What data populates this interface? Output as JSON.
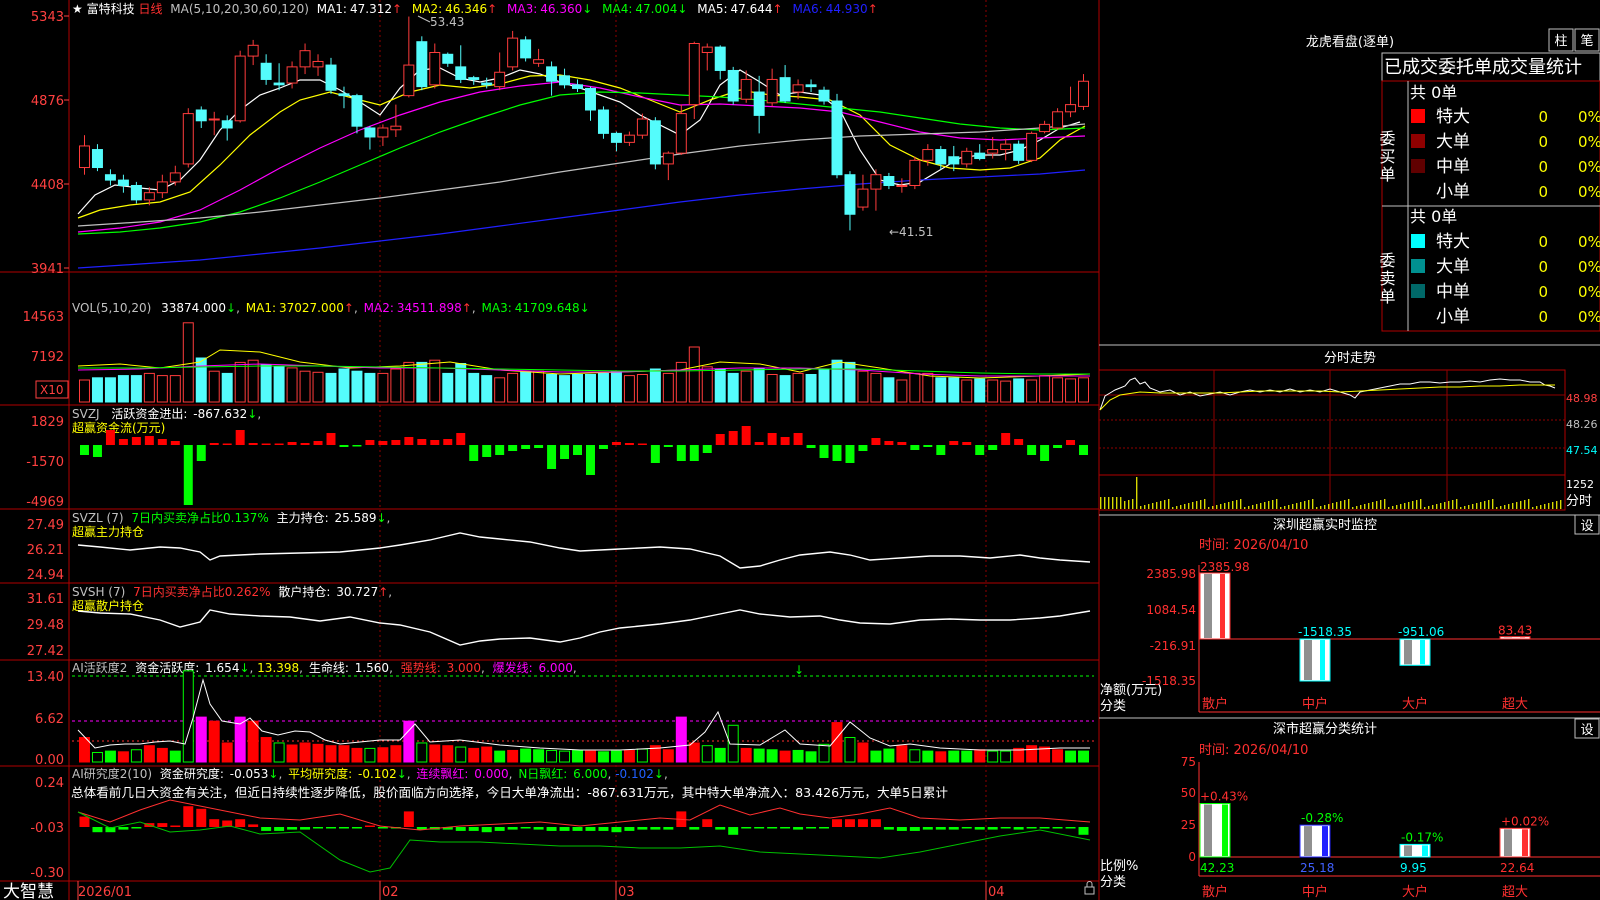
{
  "header": {
    "star": "★",
    "stock_name": "富特科技",
    "period": "日线",
    "ma_formula": "MA(5,10,20,30,60,120)",
    "ma_values": [
      {
        "label": "MA1:",
        "value": "47.312",
        "arrow": "↑",
        "color": "#ffffff"
      },
      {
        "label": "MA2:",
        "value": "46.346",
        "arrow": "↑",
        "color": "#ffff00"
      },
      {
        "label": "MA3:",
        "value": "46.360",
        "arrow": "↓",
        "color": "#ff00ff"
      },
      {
        "label": "MA4:",
        "value": "47.004",
        "arrow": "↓",
        "color": "#00ff00"
      },
      {
        "label": "MA5:",
        "value": "47.644",
        "arrow": "↑",
        "color": "#c0c0c0"
      },
      {
        "label": "MA6:",
        "value": "44.930",
        "arrow": "↑",
        "color": "#2020ff"
      }
    ]
  },
  "price_axis": [
    "5343",
    "4876",
    "4408",
    "3941"
  ],
  "price_annotations": {
    "high": "53.43",
    "low": "←41.51"
  },
  "volume_panel": {
    "title": "VOL(5,10,20)",
    "value": "33874.000",
    "value_arrow": "↓",
    "ma": [
      {
        "label": "MA1:",
        "value": "37027.000",
        "arrow": "↑",
        "color": "#ffff00"
      },
      {
        "label": "MA2:",
        "value": "34511.898",
        "arrow": "↑",
        "color": "#ff00ff"
      },
      {
        "label": "MA3:",
        "value": "41709.648",
        "arrow": "↓",
        "color": "#00ff00"
      }
    ],
    "axis": [
      "14563",
      "7192"
    ],
    "unit": "X10"
  },
  "svzj_panel": {
    "title": "SVZJ",
    "label": "活跃资金进出:",
    "value": "-867.632",
    "arrow": "↓",
    "sub": "超赢资金流(万元)",
    "axis": [
      "1829",
      "-1570",
      "-4969"
    ]
  },
  "svzl_panel": {
    "title": "SVZL (7)",
    "pct_label": "7日内买卖净占比",
    "pct": "0.137%",
    "hold_label": "主力持仓:",
    "hold": "25.589",
    "arrow": "↓",
    "sub": "超赢主力持仓",
    "axis": [
      "27.49",
      "26.21",
      "24.94"
    ]
  },
  "svsh_panel": {
    "title": "SVSH (7)",
    "pct_label": "7日内买卖净占比",
    "pct": "0.262%",
    "hold_label": "散户持仓:",
    "hold": "30.727",
    "arrow": "↑",
    "sub": "超赢散户持仓",
    "axis": [
      "31.61",
      "29.48",
      "27.42"
    ]
  },
  "ai_active_panel": {
    "title": "AI活跃度2",
    "label1": "资金活跃度:",
    "value1": "1.654",
    "arrow1": "↓",
    "value2": "13.398",
    "label3": "生命线:",
    "value3": "1.560",
    "label4": "强势线:",
    "value4": "3.000",
    "label5": "爆发线:",
    "value5": "6.000",
    "axis": [
      "13.40",
      "6.62",
      "0.00"
    ]
  },
  "ai_research_panel": {
    "title": "AI研究度2(10)",
    "label1": "资金研究度:",
    "value1": "-0.053",
    "arrow1": "↓",
    "label2": "平均研究度:",
    "value2": "-0.102",
    "arrow2": "↓",
    "label3": "连续飘红:",
    "value3": "0.000",
    "label4": "N日飘红:",
    "value4": "6.000",
    "value5": "-0.102",
    "arrow5": "↓",
    "summary": "总体看前几日大资金有关注，但近日持续性逐步降低，股价面临方向选择，今日大单净流出：-867.631万元，其中特大单净流入：83.426万元，大单5日累计",
    "axis": [
      "0.24",
      "-0.03",
      "-0.30"
    ]
  },
  "date_axis": {
    "brand": "大智慧",
    "labels": [
      "2026/01",
      "02",
      "03",
      "04"
    ]
  },
  "right_panel": {
    "dragon_tiger": {
      "title": "龙虎看盘(逐单)",
      "btn_bar": "柱",
      "btn_pen": "笔",
      "tabs_text": "已成交委托单成交量统计",
      "buy_side": "委买单",
      "sell_side": "委卖单",
      "buy_total": "共 0单",
      "sell_total": "共 0单",
      "buy_rows": [
        {
          "label": "特大",
          "count": "0",
          "pct": "0%",
          "color": "#ff0000"
        },
        {
          "label": "大单",
          "count": "0",
          "pct": "0%",
          "color": "#900000"
        },
        {
          "label": "中单",
          "count": "0",
          "pct": "0%",
          "color": "#600000"
        },
        {
          "label": "小单",
          "count": "0",
          "pct": "0%",
          "color": "#000000"
        }
      ],
      "sell_rows": [
        {
          "label": "特大",
          "count": "0",
          "pct": "0%",
          "color": "#00ffff"
        },
        {
          "label": "大单",
          "count": "0",
          "pct": "0%",
          "color": "#009090"
        },
        {
          "label": "中单",
          "count": "0",
          "pct": "0%",
          "color": "#006868"
        },
        {
          "label": "小单",
          "count": "0",
          "pct": "0%",
          "color": "#000000"
        }
      ]
    },
    "intraday": {
      "title": "分时走势",
      "axis": [
        "48.98",
        "48.26",
        "47.54",
        "1252"
      ],
      "vol_label": "分时"
    },
    "sz_monitor": {
      "title": "深圳超赢实时监控",
      "btn": "设",
      "time": "时间: 2026/04/10",
      "axis": [
        "2385.98",
        "1084.54",
        "-216.91",
        "-1518.35"
      ],
      "ylabel": "净额(万元)",
      "xlabel": "分类",
      "categories": [
        "散户",
        "中户",
        "大户",
        "超大"
      ],
      "values": [
        "2385.98",
        "-1518.35",
        "-951.06",
        "83.43"
      ]
    },
    "sz_classify": {
      "title": "深市超赢分类统计",
      "btn": "设",
      "time": "时间: 2026/04/10",
      "axis": [
        "75",
        "50",
        "25",
        "0"
      ],
      "ylabel": "比例%",
      "xlabel": "分类",
      "categories": [
        "散户",
        "中户",
        "大户",
        "超大"
      ],
      "top_labels": [
        "+0.43%",
        "-0.28%",
        "-0.17%",
        "+0.02%"
      ],
      "bottom_labels": [
        "42.23",
        "25.18",
        "9.95",
        "22.64"
      ]
    }
  },
  "colors": {
    "up": "#ff3c3c",
    "down": "#54fcfc",
    "grid": "#b00000",
    "axis_text": "#ff4040",
    "ma1": "#ffffff",
    "ma2": "#ffff00",
    "ma3": "#ff00ff",
    "ma4": "#00ff00",
    "ma5": "#c0c0c0",
    "ma6": "#2020ff"
  },
  "chart_data": {
    "type": "candlestick",
    "candles": [
      [
        45.0,
        46.2,
        44.6,
        46.8
      ],
      [
        46.0,
        45.0,
        44.8,
        46.3
      ],
      [
        44.6,
        44.3,
        44.0,
        44.9
      ],
      [
        44.3,
        44.0,
        43.6,
        44.6
      ],
      [
        44.0,
        43.2,
        43.0,
        44.2
      ],
      [
        43.2,
        43.6,
        42.9,
        43.9
      ],
      [
        43.6,
        44.2,
        43.3,
        44.6
      ],
      [
        44.2,
        44.7,
        44.0,
        45.1
      ],
      [
        45.2,
        48.0,
        45.0,
        48.3
      ],
      [
        48.2,
        47.6,
        47.2,
        48.4
      ],
      [
        47.7,
        47.7,
        46.8,
        48.1
      ],
      [
        47.6,
        47.2,
        46.5,
        47.9
      ],
      [
        47.6,
        51.2,
        47.5,
        51.5
      ],
      [
        51.2,
        51.8,
        50.7,
        52.1
      ],
      [
        50.8,
        49.9,
        49.6,
        51.3
      ],
      [
        49.7,
        49.6,
        49.3,
        50.8
      ],
      [
        49.7,
        50.6,
        49.4,
        50.9
      ],
      [
        50.6,
        51.5,
        50.2,
        51.9
      ],
      [
        50.6,
        50.9,
        50.1,
        51.3
      ],
      [
        50.7,
        49.3,
        49.1,
        51.1
      ],
      [
        49.1,
        49.0,
        48.3,
        49.5
      ],
      [
        49.0,
        47.3,
        46.9,
        49.1
      ],
      [
        47.2,
        46.7,
        46.0,
        47.3
      ],
      [
        46.7,
        47.2,
        46.2,
        47.4
      ],
      [
        47.1,
        47.3,
        46.7,
        48.5
      ],
      [
        49.0,
        50.7,
        48.9,
        53.4
      ],
      [
        52.0,
        49.5,
        49.3,
        52.3
      ],
      [
        49.6,
        51.4,
        49.4,
        51.9
      ],
      [
        51.3,
        50.8,
        50.6,
        51.4
      ],
      [
        50.6,
        49.9,
        49.7,
        51.8
      ],
      [
        50.0,
        49.9,
        49.6,
        50.1
      ],
      [
        49.7,
        49.6,
        49.4,
        50.0
      ],
      [
        49.5,
        50.3,
        49.3,
        51.4
      ],
      [
        50.6,
        52.2,
        50.4,
        52.6
      ],
      [
        52.1,
        51.1,
        50.9,
        52.3
      ],
      [
        50.8,
        51.0,
        50.6,
        51.6
      ],
      [
        50.6,
        49.8,
        49.0,
        50.9
      ],
      [
        50.1,
        49.6,
        49.4,
        50.5
      ],
      [
        49.6,
        49.4,
        49.2,
        49.9
      ],
      [
        49.4,
        48.2,
        47.6,
        49.5
      ],
      [
        48.2,
        46.9,
        46.6,
        48.4
      ],
      [
        46.9,
        46.4,
        45.9,
        47.0
      ],
      [
        46.4,
        46.8,
        46.2,
        47.0
      ],
      [
        46.8,
        47.7,
        46.6,
        48.0
      ],
      [
        47.6,
        45.2,
        44.9,
        47.8
      ],
      [
        45.2,
        45.8,
        44.3,
        45.9
      ],
      [
        45.8,
        48.0,
        45.7,
        48.5
      ],
      [
        48.5,
        51.9,
        47.7,
        52.0
      ],
      [
        51.4,
        51.7,
        50.4,
        51.9
      ],
      [
        51.7,
        50.4,
        49.9,
        51.8
      ],
      [
        50.4,
        48.7,
        48.5,
        50.6
      ],
      [
        48.8,
        49.9,
        48.6,
        50.4
      ],
      [
        49.2,
        47.9,
        46.9,
        50.1
      ],
      [
        48.6,
        49.9,
        48.4,
        50.5
      ],
      [
        50.0,
        48.7,
        48.6,
        50.7
      ],
      [
        49.2,
        49.6,
        48.8,
        49.9
      ],
      [
        49.6,
        49.5,
        49.2,
        49.9
      ],
      [
        49.3,
        48.7,
        48.5,
        49.5
      ],
      [
        48.7,
        44.6,
        44.4,
        49.1
      ],
      [
        44.6,
        42.4,
        41.5,
        44.8
      ],
      [
        42.8,
        43.8,
        42.6,
        44.6
      ],
      [
        43.8,
        44.6,
        42.6,
        44.9
      ],
      [
        44.5,
        44.0,
        43.8,
        44.7
      ],
      [
        44.0,
        44.0,
        43.6,
        44.4
      ],
      [
        44.0,
        45.4,
        43.8,
        45.6
      ],
      [
        45.4,
        46.0,
        45.1,
        46.3
      ],
      [
        46.0,
        45.2,
        44.9,
        46.2
      ],
      [
        45.6,
        45.2,
        44.8,
        46.2
      ],
      [
        45.2,
        45.9,
        45.0,
        46.1
      ],
      [
        45.8,
        45.5,
        45.4,
        46.3
      ],
      [
        45.8,
        46.0,
        45.5,
        46.7
      ],
      [
        46.0,
        46.3,
        45.4,
        46.6
      ],
      [
        46.3,
        45.4,
        45.2,
        46.5
      ],
      [
        45.4,
        46.9,
        45.3,
        47.0
      ],
      [
        47.0,
        47.4,
        46.9,
        47.6
      ],
      [
        47.2,
        48.1,
        47.1,
        48.3
      ],
      [
        48.1,
        48.5,
        47.8,
        49.5
      ],
      [
        48.4,
        49.8,
        48.2,
        50.2
      ]
    ]
  }
}
